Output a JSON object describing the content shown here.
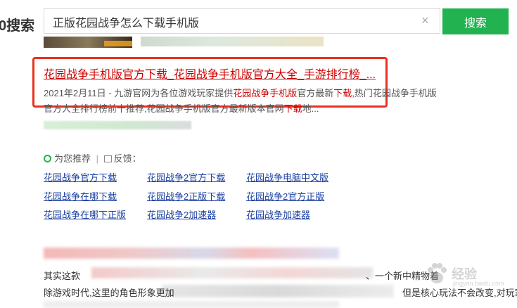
{
  "header": {
    "logo": "0搜索",
    "query": "正版花园战争怎么下载手机版",
    "clear_icon": "close-icon",
    "search_button": "搜索"
  },
  "result": {
    "title": "花园战争手机版官方下载_花园战争手机版官方大全_手游排行榜_...",
    "date": "2021年2月11日 -",
    "snippet_parts": [
      " 九游官网为各位游戏玩家提供",
      "花园战争手机版",
      "官方最新",
      "下载",
      ",热门花园战争手机版官方大全排行榜前十推荐,花园战争手机版官方最新版本官网",
      "下载",
      "地..."
    ]
  },
  "recommend": {
    "label": "为您推荐",
    "feedback": "反馈：",
    "links": [
      [
        "花园战争官方下载",
        "花园战争2官方下载",
        "花园战争电脑中文版"
      ],
      [
        "花园战争在哪下载",
        "花园战争2正版下载",
        "花园战争2官方正版"
      ],
      [
        "花园战争在哪下正版",
        "花园战争2加速器",
        "花园战争加速器"
      ]
    ]
  },
  "next_result": {
    "line1_left": "其实这款",
    "line1_right": "、一个新中精物着",
    "line2_left": "除游戏时代,这里的角色形象更加",
    "line2_right": "但是核心玩法不会改变,对玩家来..."
  },
  "watermark": {
    "text": "经验",
    "url": "jingyan.baidu.com"
  }
}
